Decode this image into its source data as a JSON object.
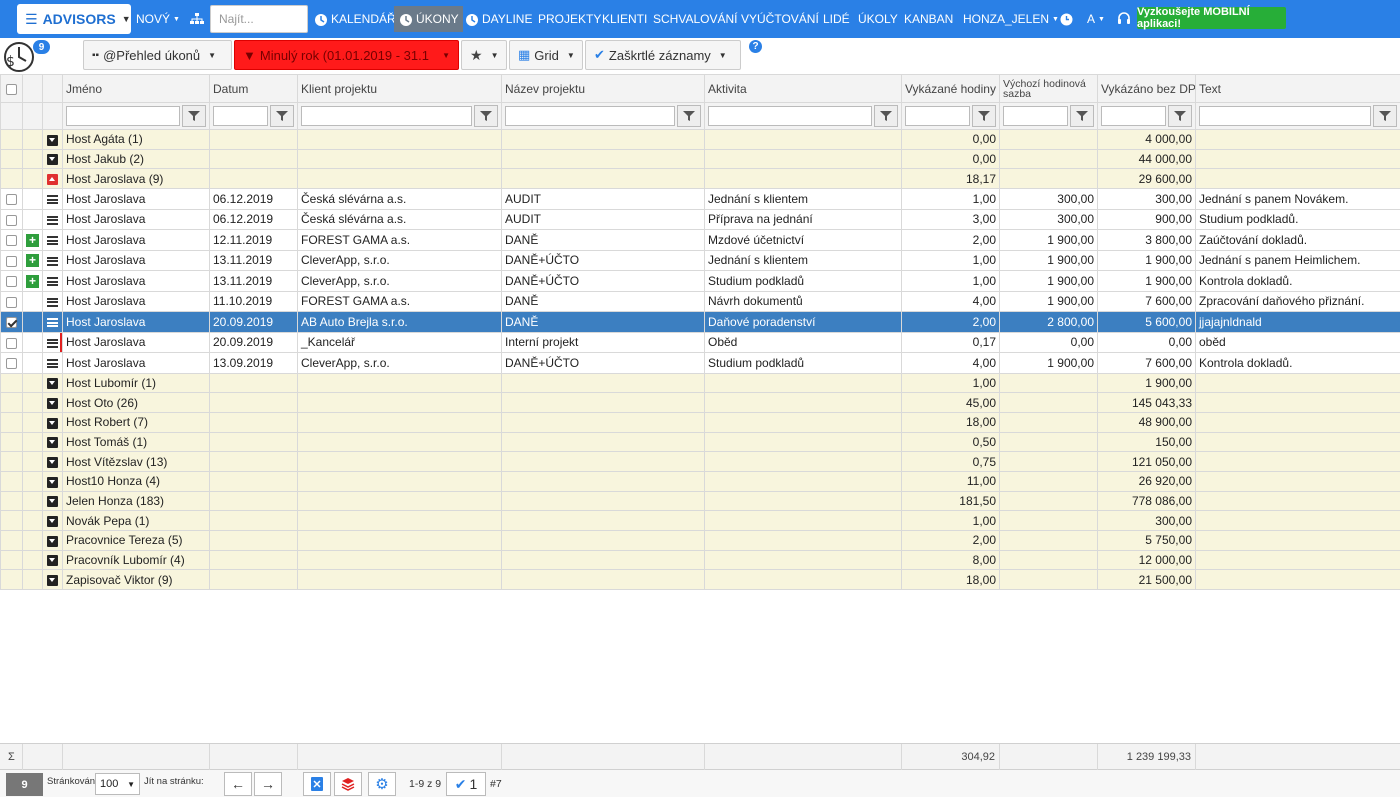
{
  "navbar": {
    "brand": "ADVISORS",
    "new_label": "NOVÝ",
    "search_placeholder": "Najít...",
    "items": [
      "KALENDÁŘ",
      "ÚKONY",
      "DAYLINE",
      "PROJEKTY",
      "KLIENTI",
      "SCHVALOVÁNÍ",
      "VYÚČTOVÁNÍ",
      "LIDÉ",
      "ÚKOLY",
      "KANBAN",
      "HONZA_JELEN"
    ],
    "lang": "A",
    "mobile_app": "Vyzkoušejte MOBILNÍ aplikaci!",
    "accent": "#2a80e6"
  },
  "toolbar": {
    "badge": "9",
    "view": "@Přehled úkonů",
    "filter": "Minulý rok (01.01.2019 - 31.1",
    "layout": "Grid",
    "checked": "Zaškrtlé záznamy",
    "filter_color": "#ff1a1a"
  },
  "columns": [
    "Jméno",
    "Datum",
    "Klient projektu",
    "Název projektu",
    "Aktivita",
    "Vykázané hodiny",
    "Výchozí hodinová sazba",
    "Vykázáno bez DPH",
    "Text"
  ],
  "rows": [
    {
      "type": "group",
      "name": "Host Agáta (1)",
      "hours": "0,00",
      "amount": "4 000,00"
    },
    {
      "type": "group",
      "name": "Host Jakub (2)",
      "hours": "0,00",
      "amount": "44 000,00"
    },
    {
      "type": "group-open",
      "name": "Host Jaroslava (9)",
      "hours": "18,17",
      "amount": "29 600,00"
    },
    {
      "type": "data",
      "name": "Host Jaroslava",
      "date": "06.12.2019",
      "client": "Česká slévárna a.s.",
      "project": "AUDIT",
      "activity": "Jednání s klientem",
      "hours": "1,00",
      "rate": "300,00",
      "amount": "300,00",
      "text": "Jednání s panem Novákem."
    },
    {
      "type": "data",
      "name": "Host Jaroslava",
      "date": "06.12.2019",
      "client": "Česká slévárna a.s.",
      "project": "AUDIT",
      "activity": "Příprava na jednání",
      "hours": "3,00",
      "rate": "300,00",
      "amount": "900,00",
      "text": "Studium podkladů."
    },
    {
      "type": "data",
      "plus": true,
      "name": "Host Jaroslava",
      "date": "12.11.2019",
      "client": "FOREST GAMA a.s.",
      "project": "DANĚ",
      "activity": "Mzdové účetnictví",
      "hours": "2,00",
      "rate": "1 900,00",
      "amount": "3 800,00",
      "text": "Zaúčtování dokladů."
    },
    {
      "type": "data",
      "plus": true,
      "name": "Host Jaroslava",
      "date": "13.11.2019",
      "client": "CleverApp, s.r.o.",
      "project": "DANĚ+ÚČTO",
      "activity": "Jednání s klientem",
      "hours": "1,00",
      "rate": "1 900,00",
      "amount": "1 900,00",
      "text": "Jednání s panem Heimlichem."
    },
    {
      "type": "data",
      "plus": true,
      "name": "Host Jaroslava",
      "date": "13.11.2019",
      "client": "CleverApp, s.r.o.",
      "project": "DANĚ+ÚČTO",
      "activity": "Studium podkladů",
      "hours": "1,00",
      "rate": "1 900,00",
      "amount": "1 900,00",
      "text": "Kontrola dokladů."
    },
    {
      "type": "data",
      "name": "Host Jaroslava",
      "date": "11.10.2019",
      "client": "FOREST GAMA a.s.",
      "project": "DANĚ",
      "activity": "Návrh dokumentů",
      "hours": "4,00",
      "rate": "1 900,00",
      "amount": "7 600,00",
      "text": "Zpracování daňového přiznání."
    },
    {
      "type": "data",
      "selected": true,
      "name": "Host Jaroslava",
      "date": "20.09.2019",
      "client": "AB Auto Brejla s.r.o.",
      "project": "DANĚ",
      "activity": "Daňové poradenství",
      "hours": "2,00",
      "rate": "2 800,00",
      "amount": "5 600,00",
      "text": "jjajajnldnald"
    },
    {
      "type": "data",
      "redmark": true,
      "name": "Host Jaroslava",
      "date": "20.09.2019",
      "client": "_Kancelář",
      "project": "Interní projekt",
      "activity": "Oběd",
      "hours": "0,17",
      "rate": "0,00",
      "amount": "0,00",
      "text": "oběd"
    },
    {
      "type": "data",
      "name": "Host Jaroslava",
      "date": "13.09.2019",
      "client": "CleverApp, s.r.o.",
      "project": "DANĚ+ÚČTO",
      "activity": "Studium podkladů",
      "hours": "4,00",
      "rate": "1 900,00",
      "amount": "7 600,00",
      "text": "Kontrola dokladů."
    },
    {
      "type": "group",
      "name": "Host Lubomír (1)",
      "hours": "1,00",
      "amount": "1 900,00"
    },
    {
      "type": "group",
      "name": "Host Oto (26)",
      "hours": "45,00",
      "amount": "145 043,33"
    },
    {
      "type": "group",
      "name": "Host Robert (7)",
      "hours": "18,00",
      "amount": "48 900,00"
    },
    {
      "type": "group",
      "name": "Host Tomáš (1)",
      "hours": "0,50",
      "amount": "150,00"
    },
    {
      "type": "group",
      "name": "Host Vítězslav (13)",
      "hours": "0,75",
      "amount": "121 050,00"
    },
    {
      "type": "group",
      "name": "Host10 Honza (4)",
      "hours": "11,00",
      "amount": "26 920,00"
    },
    {
      "type": "group",
      "name": "Jelen Honza (183)",
      "hours": "181,50",
      "amount": "778 086,00"
    },
    {
      "type": "group",
      "name": "Novák Pepa (1)",
      "hours": "1,00",
      "amount": "300,00"
    },
    {
      "type": "group",
      "name": "Pracovnice Tereza (5)",
      "hours": "2,00",
      "amount": "5 750,00"
    },
    {
      "type": "group",
      "name": "Pracovník Lubomír (4)",
      "hours": "8,00",
      "amount": "12 000,00"
    },
    {
      "type": "group",
      "name": "Zapisovač Viktor (9)",
      "hours": "18,00",
      "amount": "21 500,00"
    }
  ],
  "totals": {
    "sigma": "Σ",
    "hours": "304,92",
    "amount": "1 239 199,33"
  },
  "pager": {
    "count": "9",
    "paging_label": "Stránkování:",
    "page_size": "100",
    "goto_label": "Jít na stránku:",
    "range": "1-9 z 9",
    "checked_count": "1",
    "total": "#7"
  }
}
